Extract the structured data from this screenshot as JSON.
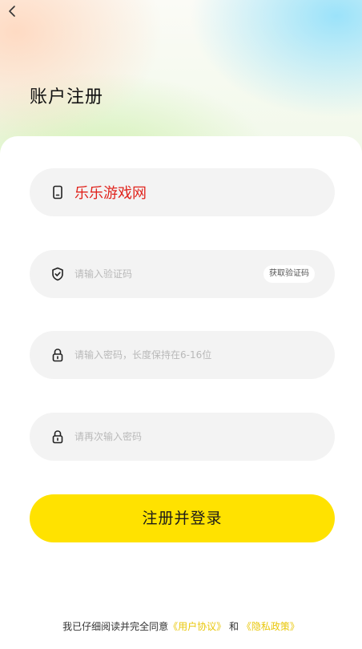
{
  "header": {
    "back_label": "<",
    "title": "账户注册"
  },
  "form": {
    "phone": {
      "value": "乐乐游戏网"
    },
    "code": {
      "placeholder": "请输入验证码",
      "button_label": "获取验证码"
    },
    "password": {
      "placeholder": "请输入密码，长度保持在6-16位"
    },
    "confirm": {
      "placeholder": "请再次输入密码"
    },
    "submit_label": "注册并登录"
  },
  "agreement": {
    "prefix": "我已仔细阅读并完全同意",
    "user_agreement": "《用户协议》",
    "and": "和",
    "privacy_policy": "《隐私政策》"
  },
  "colors": {
    "accent": "#ffe200",
    "link": "#e9c70a",
    "field_bg": "#f3f3f3"
  },
  "icons": [
    "back-arrow-icon",
    "phone-icon",
    "shield-icon",
    "lock-icon"
  ]
}
